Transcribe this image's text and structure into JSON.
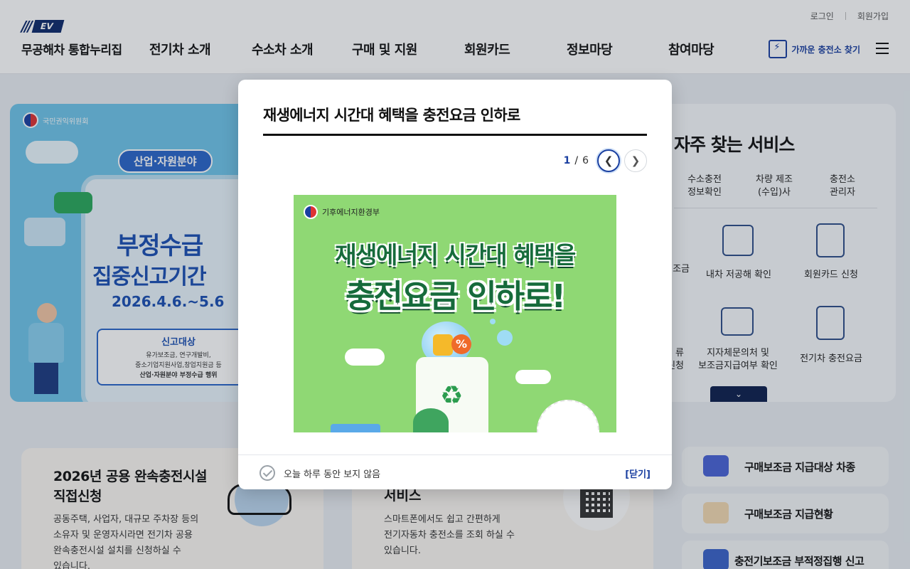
{
  "header": {
    "util": {
      "login": "로그인",
      "signup": "회원가입"
    },
    "logo": {
      "badge": "EV",
      "text": "무공해차 통합누리집"
    },
    "nav": [
      "전기차 소개",
      "수소차 소개",
      "구매 및 지원",
      "회원카드",
      "정보마당",
      "참여마당"
    ],
    "find_station": "가까운 충전소 찾기"
  },
  "banner": {
    "org": "국민권익위원회",
    "pill": "산업·자원분야",
    "title1": "부정수급",
    "title2": "집중신고기간",
    "date": "2026.4.6.~5.6",
    "box_title": "신고대상",
    "box_lines": [
      "유가보조금, 연구개발비,",
      "중소기업지원사업,창업지원금 등",
      "산업·자원분야 부정수급 행위"
    ]
  },
  "services": {
    "title": "자주 찾는 서비스",
    "items": [
      {
        "label1": "수소충전",
        "label2": "정보확인"
      },
      {
        "label1": "차량 제조",
        "label2": "(수입)사"
      },
      {
        "label1": "충전소",
        "label2": "관리자"
      },
      {
        "label1": "조금",
        "label2": ""
      },
      {
        "label1": "내차 저공해 확인",
        "label2": ""
      },
      {
        "label1": "회원카드 신청",
        "label2": ""
      },
      {
        "label1": "류",
        "label2": "신청"
      },
      {
        "label1": "지자체문의처 및",
        "label2": "보조금지급여부 확인"
      },
      {
        "label1": "전기차 충전요금",
        "label2": ""
      }
    ],
    "more": "⌄"
  },
  "cards": {
    "card1_title_1": "2026년 공용 완속충전시설",
    "card1_title_2": "직접신청",
    "card1_desc": [
      "공동주택, 사업자, 대규모 주차장 등의",
      "소유자 및 운영자시라면 전기차 공용",
      "완속충전시설 설치를 신청하실 수",
      "있습니다."
    ],
    "card2_title": "서비스",
    "card2_desc": [
      "스마트폰에서도 쉽고 간편하게",
      "전기자동차 충전소를 조회 하실 수",
      "있습니다."
    ]
  },
  "quick_links": [
    "구매보조금 지급대상 차종",
    "구매보조금 지급현황",
    "충전기보조금 부적정집행 신고"
  ],
  "modal": {
    "title": "재생에너지 시간대 혜택을 충전요금 인하로",
    "pager": {
      "current": "1",
      "separator": "/",
      "total": "6"
    },
    "image": {
      "org": "기후에너지환경부",
      "line1": "재생에너지 시간대 혜택을",
      "line2": "충전요금 인하로!",
      "percent": "%"
    },
    "no_show_today": "오늘 하루 동안 보지 않음",
    "close": "[닫기]"
  }
}
